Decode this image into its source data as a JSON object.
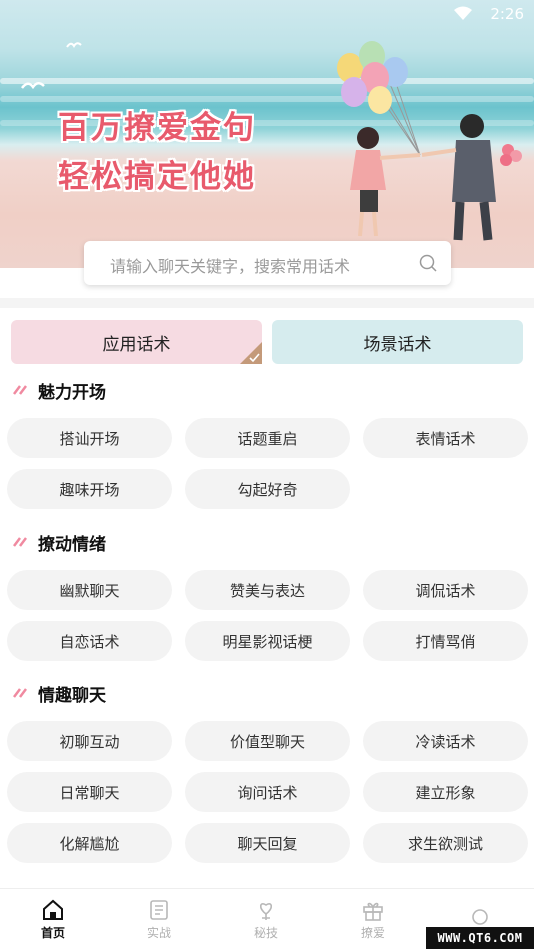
{
  "status_bar": {
    "time": "2:26",
    "wifi_icon": "wifi-icon"
  },
  "banner": {
    "slogan_line1": "百万撩爱金句",
    "slogan_line2": "轻松搞定他她"
  },
  "search": {
    "placeholder": "请输入聊天关键字，搜索常用话术",
    "icon": "search-icon"
  },
  "tabs": [
    {
      "label": "应用话术",
      "selected": true
    },
    {
      "label": "场景话术",
      "selected": false
    }
  ],
  "sections": [
    {
      "title": "魅力开场",
      "items": [
        "搭讪开场",
        "话题重启",
        "表情话术",
        "趣味开场",
        "勾起好奇"
      ]
    },
    {
      "title": "撩动情绪",
      "items": [
        "幽默聊天",
        "赞美与表达",
        "调侃话术",
        "自恋话术",
        "明星影视话梗",
        "打情骂俏"
      ]
    },
    {
      "title": "情趣聊天",
      "items": [
        "初聊互动",
        "价值型聊天",
        "冷读话术",
        "日常聊天",
        "询问话术",
        "建立形象",
        "化解尴尬",
        "聊天回复",
        "求生欲测试"
      ]
    }
  ],
  "bottom_nav": [
    {
      "label": "首页",
      "icon": "home-icon",
      "active": true
    },
    {
      "label": "实战",
      "icon": "list-icon",
      "active": false
    },
    {
      "label": "秘技",
      "icon": "heart-flower-icon",
      "active": false
    },
    {
      "label": "撩爱",
      "icon": "gift-icon",
      "active": false
    },
    {
      "label": "",
      "icon": "profile-icon",
      "active": false
    }
  ],
  "watermark": "WWW.QT6.COM",
  "colors": {
    "accent_pink": "#e85a6c",
    "tab_app_bg": "#f6dbe2",
    "tab_scene_bg": "#d6ecee",
    "pill_bg": "#f3f3f3"
  }
}
